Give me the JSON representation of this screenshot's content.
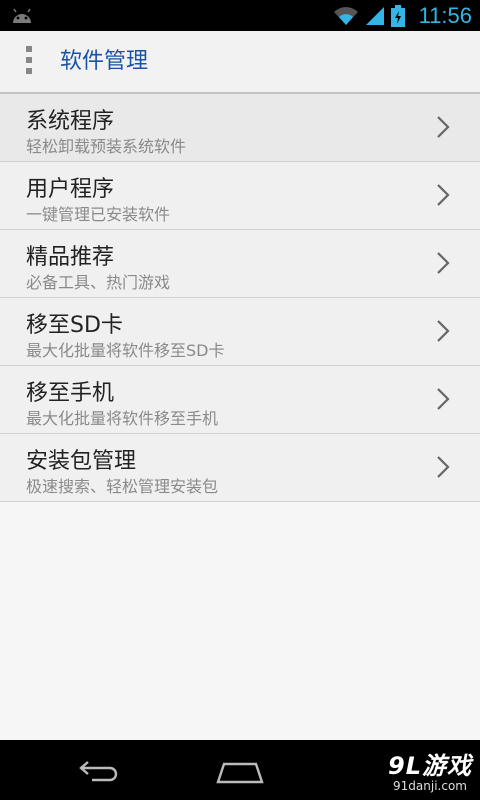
{
  "status_bar": {
    "time": "11:56",
    "icons": [
      "android-icon",
      "wifi-icon",
      "signal-icon",
      "battery-charging-icon"
    ],
    "accent_color": "#33b5e5"
  },
  "action_bar": {
    "title": "软件管理",
    "overflow_icon": "overflow-menu-icon"
  },
  "menu": {
    "items": [
      {
        "title": "系统程序",
        "subtitle": "轻松卸载预装系统软件"
      },
      {
        "title": "用户程序",
        "subtitle": "一键管理已安装软件"
      },
      {
        "title": "精品推荐",
        "subtitle": "必备工具、热门游戏"
      },
      {
        "title": "移至SD卡",
        "subtitle": "最大化批量将软件移至SD卡"
      },
      {
        "title": "移至手机",
        "subtitle": "最大化批量将软件移至手机"
      },
      {
        "title": "安装包管理",
        "subtitle": "极速搜索、轻松管理安装包"
      }
    ]
  },
  "nav_bar": {
    "icons": [
      "back-icon",
      "home-icon"
    ]
  },
  "watermark": {
    "logo": "9L游戏",
    "url": "91danji.com"
  }
}
